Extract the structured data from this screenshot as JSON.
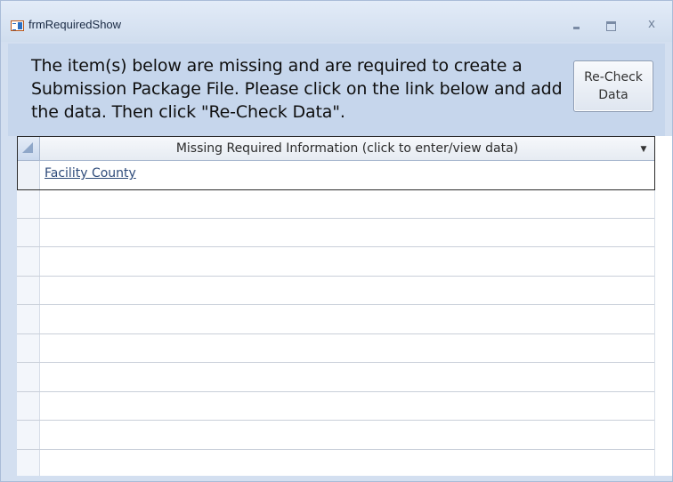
{
  "window": {
    "title": "frmRequiredShow",
    "minimize_symbol": "",
    "maximize_symbol": "",
    "close_symbol": "x"
  },
  "form": {
    "message": "The item(s) below are missing and are required to create a Submission Package File.  Please click on the link below and add the data. Then click \"Re-Check Data\".",
    "recheck_button_line1": "Re-Check",
    "recheck_button_line2": "Data"
  },
  "datasheet": {
    "column_header": "Missing Required Information (click to enter/view data)",
    "dropdown_icon": "chevron-down-icon",
    "rows": [
      "Facility County"
    ]
  },
  "colors": {
    "titlebar": "#d3dff0",
    "header_band": "#c6d6ec",
    "link_text": "#2e4b7a"
  }
}
